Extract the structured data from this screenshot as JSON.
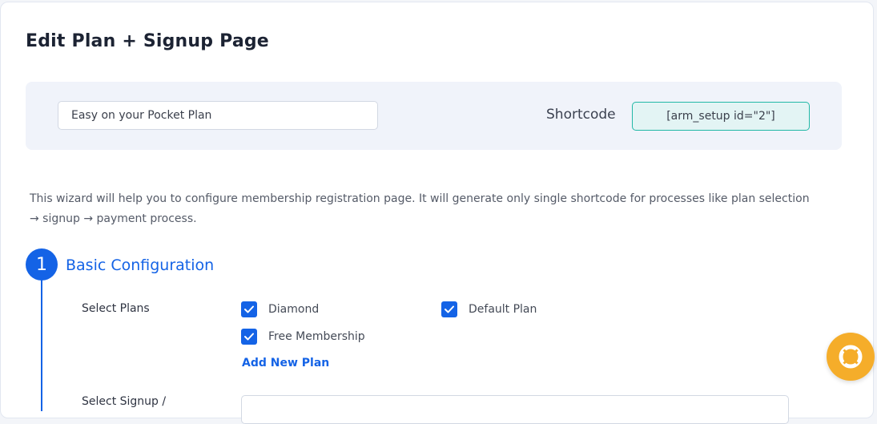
{
  "page": {
    "title": "Edit Plan + Signup Page"
  },
  "header": {
    "plan_name_value": "Easy on your Pocket Plan",
    "shortcode_label": "Shortcode",
    "shortcode_value": "[arm_setup id=\"2\"]"
  },
  "wizard": {
    "description": "This wizard will help you to configure membership registration page. It will generate only single shortcode for processes like plan selection → signup → payment process."
  },
  "step1": {
    "number": "1",
    "title": "Basic Configuration",
    "select_plans_label": "Select Plans",
    "plans": [
      {
        "label": "Diamond",
        "checked": true
      },
      {
        "label": "Default Plan",
        "checked": true
      },
      {
        "label": "Free Membership",
        "checked": true
      }
    ],
    "add_new_plan_label": "Add New Plan",
    "next_field_label": "Select Signup /"
  },
  "colors": {
    "accent": "#1463e6",
    "shortcode_border": "#22b8a6",
    "help_button": "#f5ad2a"
  },
  "icons": {
    "help": "lifebuoy-icon",
    "check": "check-icon"
  }
}
